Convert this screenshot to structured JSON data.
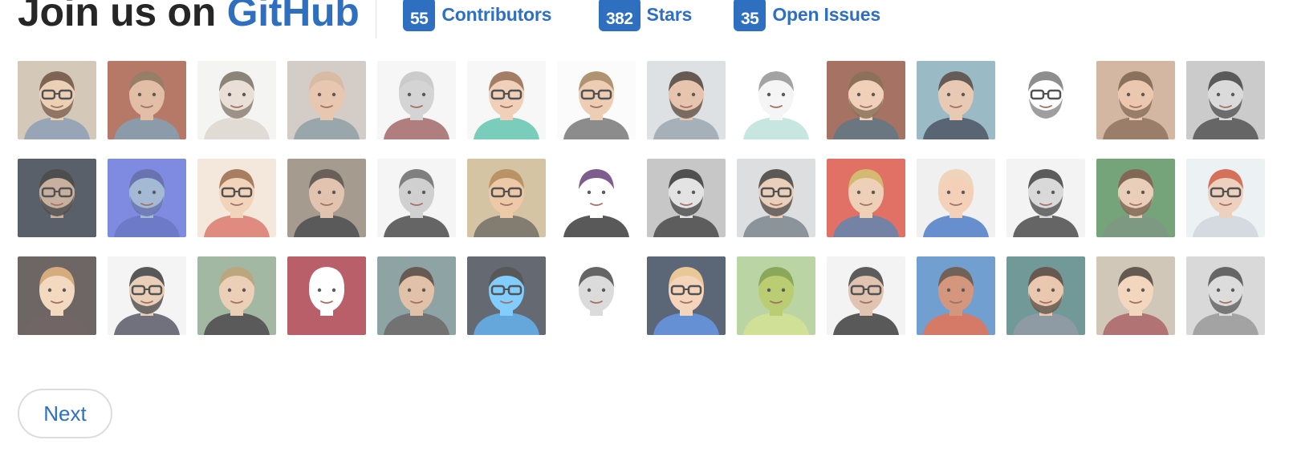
{
  "header": {
    "title_prefix": "Join us on",
    "title_brand": "GitHub"
  },
  "stats": {
    "contributors": {
      "count": "55",
      "label": "Contributors"
    },
    "stars": {
      "count": "382",
      "label": "Stars"
    },
    "issues": {
      "count": "35",
      "label": "Open Issues"
    }
  },
  "avatars": [
    {
      "bg": "#c9b9a6",
      "skin": "#e7c3a2",
      "hair": "#5b3b24",
      "shirt": "#7a8ca4",
      "glasses": true,
      "beard": true
    },
    {
      "bg": "#a4543d",
      "skin": "#d9ad8c",
      "hair": "#7b5a3d",
      "shirt": "#6b7f93",
      "glasses": false,
      "beard": false
    },
    {
      "bg": "#f2f2f0",
      "skin": "#e4d7cb",
      "hair": "#6d6254",
      "shirt": "#d8d2c8",
      "glasses": false,
      "beard": true
    },
    {
      "bg": "#c8c0b8",
      "skin": "#e1b89b",
      "hair": "#cfa98a",
      "shirt": "#7d8f96",
      "glasses": false,
      "beard": false
    },
    {
      "bg": "#f4f4f4",
      "skin": "#c8c8c8",
      "hair": "#bdbdbd",
      "shirt": "#9b5a5a",
      "glasses": false,
      "beard": false
    },
    {
      "bg": "#f6f6f6",
      "skin": "#ecc3a6",
      "hair": "#8a5a3a",
      "shirt": "#57bfa9",
      "glasses": true,
      "beard": false
    },
    {
      "bg": "#fafafa",
      "skin": "#e8bf9e",
      "hair": "#9b7548",
      "shirt": "#6d6d6d",
      "glasses": true,
      "beard": false
    },
    {
      "bg": "#d6d9dc",
      "skin": "#e1b497",
      "hair": "#3c2e24",
      "shirt": "#8d9aa6",
      "glasses": false,
      "beard": true
    },
    {
      "bg": "#ffffff",
      "skin": "#f3f3f3",
      "hair": "#8a8a8a",
      "shirt": "#b9dfd8",
      "glasses": false,
      "beard": false
    },
    {
      "bg": "#8c4b38",
      "skin": "#ecc4a5",
      "hair": "#6b4a2e",
      "shirt": "#41505d",
      "glasses": false,
      "beard": true
    },
    {
      "bg": "#7ea7b7",
      "skin": "#e2bba0",
      "hair": "#3b2f29",
      "shirt": "#2c3a4e",
      "glasses": false,
      "beard": false
    },
    {
      "bg": "#ffffff",
      "skin": "#ffffff",
      "hair": "#6f6f6f",
      "shirt": "#ffffff",
      "glasses": true,
      "beard": true
    },
    {
      "bg": "#c7a488",
      "skin": "#e5b898",
      "hair": "#6a4a2f",
      "shirt": "#7f5b3f",
      "glasses": false,
      "beard": true
    },
    {
      "bg": "#bdbdbd",
      "skin": "#d0d0d0",
      "hair": "#2c2c2c",
      "shirt": "#3c3c3c",
      "glasses": false,
      "beard": true
    },
    {
      "bg": "#2d343f",
      "skin": "#b99b85",
      "hair": "#1d1d1d",
      "shirt": "#2b3440",
      "glasses": true,
      "beard": true
    },
    {
      "bg": "#5c6bd8",
      "skin": "#8aa6c9",
      "hair": "#3f4c9b",
      "shirt": "#4356b9",
      "glasses": false,
      "beard": true
    },
    {
      "bg": "#f2e2d4",
      "skin": "#efc8a7",
      "hair": "#8f5a34",
      "shirt": "#d86b5c",
      "glasses": true,
      "beard": false
    },
    {
      "bg": "#8e7f70",
      "skin": "#dbb39a",
      "hair": "#3f352b",
      "shirt": "#2c2c2c",
      "glasses": false,
      "beard": false
    },
    {
      "bg": "#f3f3f3",
      "skin": "#c4c4c4",
      "hair": "#5c5c5c",
      "shirt": "#3b3b3b",
      "glasses": false,
      "beard": false
    },
    {
      "bg": "#c9b48a",
      "skin": "#e8bb8f",
      "hair": "#a6743b",
      "shirt": "#5e5a4a",
      "glasses": true,
      "beard": false
    },
    {
      "bg": "#ffffff",
      "skin": "#ffffff",
      "hair": "#5b2f6e",
      "shirt": "#2b2b2b",
      "glasses": false,
      "beard": false
    },
    {
      "bg": "#b8b8b8",
      "skin": "#dcdcdc",
      "hair": "#202020",
      "shirt": "#303030",
      "glasses": false,
      "beard": true
    },
    {
      "bg": "#d4d6d8",
      "skin": "#e5c2a8",
      "hair": "#2f2a26",
      "shirt": "#6b7580",
      "glasses": true,
      "beard": true
    },
    {
      "bg": "#d9493b",
      "skin": "#e9c3a3",
      "hair": "#c9a64a",
      "shirt": "#4c5f8c",
      "glasses": false,
      "beard": false
    },
    {
      "bg": "#ececec",
      "skin": "#f0c4a4",
      "hair": "#e8c9a8",
      "shirt": "#3d6fbf",
      "glasses": false,
      "beard": false
    },
    {
      "bg": "#f0f0f0",
      "skin": "#cfcfcf",
      "hair": "#2e2e2e",
      "shirt": "#3a3a3a",
      "glasses": false,
      "beard": true
    },
    {
      "bg": "#4f8a55",
      "skin": "#e4c2a6",
      "hair": "#5e3e25",
      "shirt": "#597d5f",
      "glasses": false,
      "beard": true
    },
    {
      "bg": "#e7eef2",
      "skin": "#e8c5ad",
      "hair": "#c94a2e",
      "shirt": "#c8d0d8",
      "glasses": true,
      "beard": false
    },
    {
      "bg": "#463b3a",
      "skin": "#efcfae",
      "hair": "#c8955b",
      "shirt": "#4a3a3a",
      "glasses": false,
      "beard": false
    },
    {
      "bg": "#f1f1f1",
      "skin": "#e5c2a5",
      "hair": "#2a2a2a",
      "shirt": "#4a4a5a",
      "glasses": true,
      "beard": true
    },
    {
      "bg": "#8aa58a",
      "skin": "#e6c2a2",
      "hair": "#a88f5a",
      "shirt": "#2c2c2c",
      "glasses": false,
      "beard": false
    },
    {
      "bg": "#a63340",
      "skin": "#ffffff",
      "hair": "#ffffff",
      "shirt": "#a63340",
      "glasses": false,
      "beard": false
    },
    {
      "bg": "#6f8a8a",
      "skin": "#d9b08f",
      "hair": "#3d2c22",
      "shirt": "#4b4b4b",
      "glasses": false,
      "beard": false
    },
    {
      "bg": "#3a3f4a",
      "skin": "#5ec0ff",
      "hair": "#2a2a2a",
      "shirt": "#3a8fd0",
      "glasses": true,
      "beard": false
    },
    {
      "bg": "#ffffff",
      "skin": "#d2d2d2",
      "hair": "#3a3a3a",
      "shirt": "#ffffff",
      "glasses": false,
      "beard": false
    },
    {
      "bg": "#2e3c52",
      "skin": "#f2c9a9",
      "hair": "#e5b87a",
      "shirt": "#3b73c9",
      "glasses": true,
      "beard": false
    },
    {
      "bg": "#a8c98a",
      "skin": "#a8c04c",
      "hair": "#6a8f2c",
      "shirt": "#c4d97a",
      "glasses": false,
      "beard": false
    },
    {
      "bg": "#f0f0f0",
      "skin": "#d8b39a",
      "hair": "#2f2f2f",
      "shirt": "#2b2b2b",
      "glasses": true,
      "beard": false
    },
    {
      "bg": "#4a86c4",
      "skin": "#c97a5a",
      "hair": "#4b3527",
      "shirt": "#c9553c",
      "glasses": false,
      "beard": false
    },
    {
      "bg": "#4a7d7a",
      "skin": "#e5b99b",
      "hair": "#3d2b1e",
      "shirt": "#6f7f8c",
      "glasses": false,
      "beard": true
    },
    {
      "bg": "#c5b8a5",
      "skin": "#efcbad",
      "hair": "#3b2c22",
      "shirt": "#9c4d4d",
      "glasses": false,
      "beard": false
    },
    {
      "bg": "#cfcfcf",
      "skin": "#d3d3d3",
      "hair": "#3c3c3c",
      "shirt": "#8a8a8a",
      "glasses": false,
      "beard": true
    }
  ],
  "pagination": {
    "next_label": "Next"
  }
}
